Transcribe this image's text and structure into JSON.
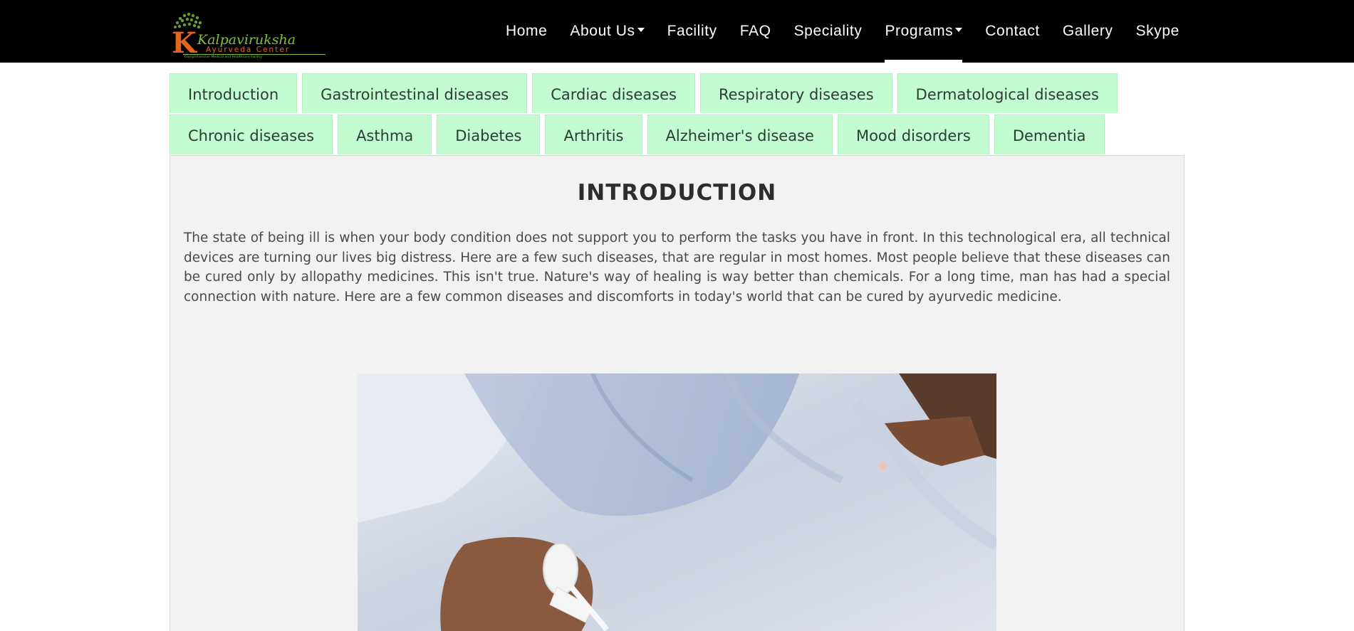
{
  "brand": {
    "logo_title": "Kalpaviruksha",
    "logo_subtitle": "Ayurveda Center",
    "logo_tagline": "Comprehensive Medical and Healthcare Facility"
  },
  "nav": {
    "items": [
      {
        "label": "Home"
      },
      {
        "label": "About Us",
        "dropdown": true
      },
      {
        "label": "Facility"
      },
      {
        "label": "FAQ"
      },
      {
        "label": "Speciality"
      },
      {
        "label": "Programs",
        "dropdown": true,
        "active": true
      },
      {
        "label": "Contact"
      },
      {
        "label": "Gallery"
      },
      {
        "label": "Skype"
      }
    ]
  },
  "tabs": {
    "row1": [
      "Introduction",
      "Gastrointestinal diseases",
      "Cardiac diseases",
      "Respiratory diseases",
      "Dermatological diseases"
    ],
    "row2": [
      "Chronic diseases",
      "Asthma",
      "Diabetes",
      "Arthritis",
      "Alzheimer's disease",
      "Mood disorders",
      "Dementia"
    ]
  },
  "content": {
    "title": "INTRODUCTION",
    "body": "The state of being ill is when your body condition does not support you to perform the tasks you have in front. In this technological era, all technical devices are turning our lives big distress. Here are a few such diseases, that are regular in most homes. Most people believe that these diseases can be cured only by allopathy medicines. This isn't true. Nature's way of healing is way better than chemicals. For a long time, man has had a special connection with nature. Here are a few common diseases and discomforts in today's world that can be cured by ayurvedic medicine."
  },
  "colors": {
    "navbar_bg": "#000000",
    "tab_bg": "#c2fcd0",
    "panel_bg": "#f2f2f2"
  }
}
